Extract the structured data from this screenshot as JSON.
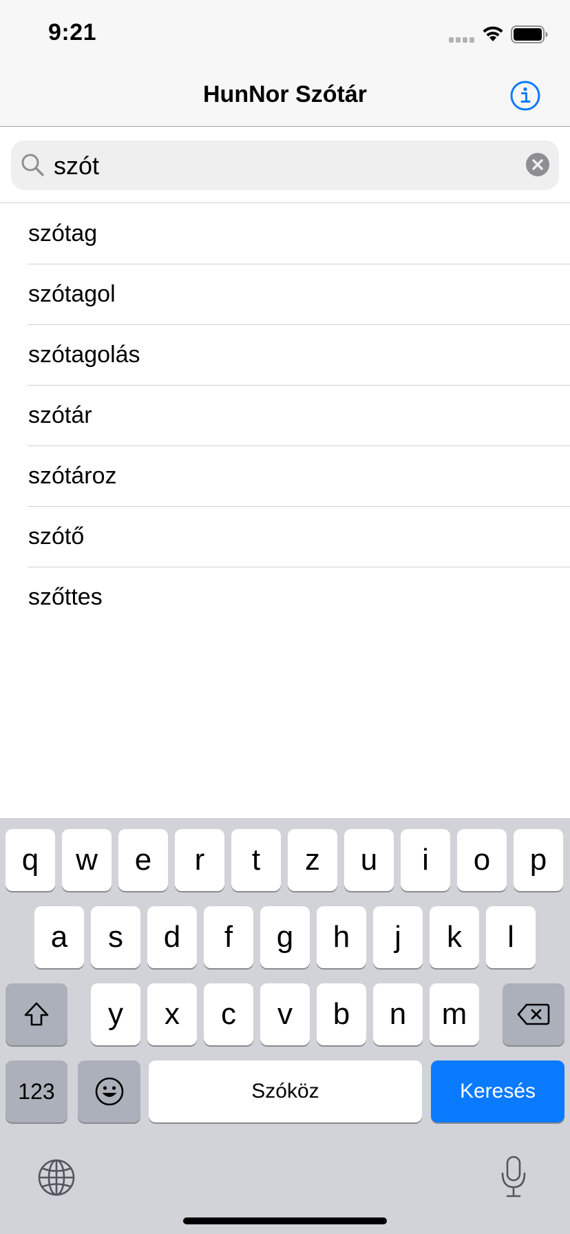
{
  "status_bar": {
    "time": "9:21"
  },
  "nav": {
    "title": "HunNor Szótár"
  },
  "search": {
    "value": "szót"
  },
  "results": [
    "szótag",
    "szótagol",
    "szótagolás",
    "szótár",
    "szótároz",
    "szótő",
    "szőttes"
  ],
  "keyboard": {
    "row1": [
      "q",
      "w",
      "e",
      "r",
      "t",
      "z",
      "u",
      "i",
      "o",
      "p"
    ],
    "row2": [
      "a",
      "s",
      "d",
      "f",
      "g",
      "h",
      "j",
      "k",
      "l"
    ],
    "row3": [
      "y",
      "x",
      "c",
      "v",
      "b",
      "n",
      "m"
    ],
    "numbers_label": "123",
    "space_label": "Szóköz",
    "return_label": "Keresés"
  },
  "colors": {
    "accent": "#0a7aff",
    "keyboard_bg": "#d1d3d9"
  }
}
